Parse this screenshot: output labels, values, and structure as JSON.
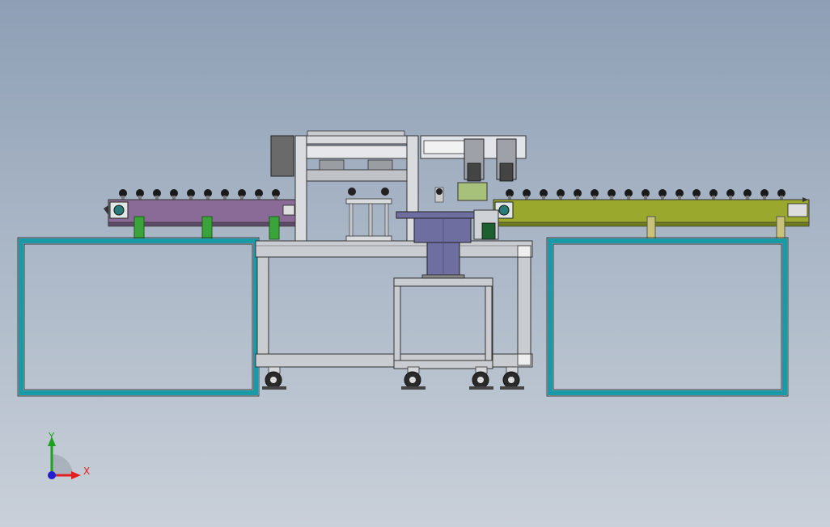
{
  "viewport": {
    "background_top": "#8e9fb5",
    "background_bottom": "#c9d0d9"
  },
  "model": {
    "left_conveyor_color": "#8a6a96",
    "right_conveyor_color": "#9aa82e",
    "guard_frame_color": "#1a9aa6",
    "frame_color": "#c9ccd1",
    "drum_color": "#6e6fa0",
    "bracket_color": "#3aa33a"
  },
  "triad": {
    "x_label": "X",
    "y_label": "Y",
    "x_color": "#e02020",
    "y_color": "#20a020",
    "z_color": "#2020d0"
  }
}
